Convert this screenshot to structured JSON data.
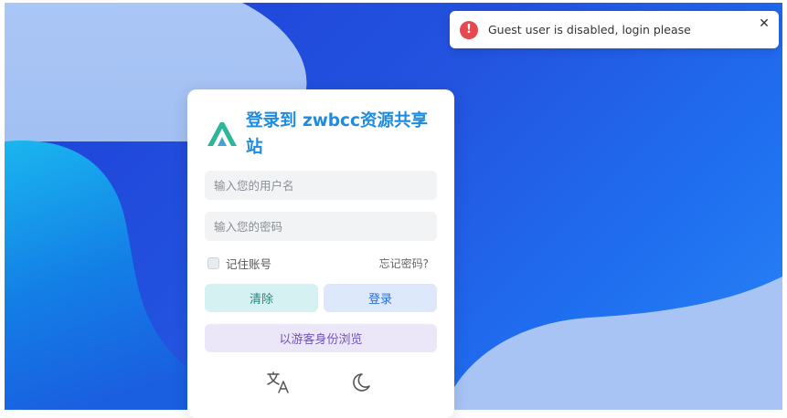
{
  "toast": {
    "icon": "error-icon",
    "icon_glyph": "!",
    "message": "Guest user is disabled, login please",
    "close_glyph": "✕"
  },
  "login": {
    "title": "登录到 zwbcc资源共享站",
    "username_placeholder": "输入您的用户名",
    "password_placeholder": "输入您的密码",
    "remember_label": "记住账号",
    "forgot_link": "忘记密码?",
    "clear_button": "清除",
    "login_button": "登录",
    "guest_button": "以游客身份浏览",
    "icons": [
      "translate-icon",
      "moon-icon"
    ]
  },
  "colors": {
    "accent": "#1e8be0",
    "error": "#e5484d",
    "clear_bg": "#d6f1f1",
    "login_bg": "#dde9fb",
    "guest_bg": "#ece6f9"
  }
}
